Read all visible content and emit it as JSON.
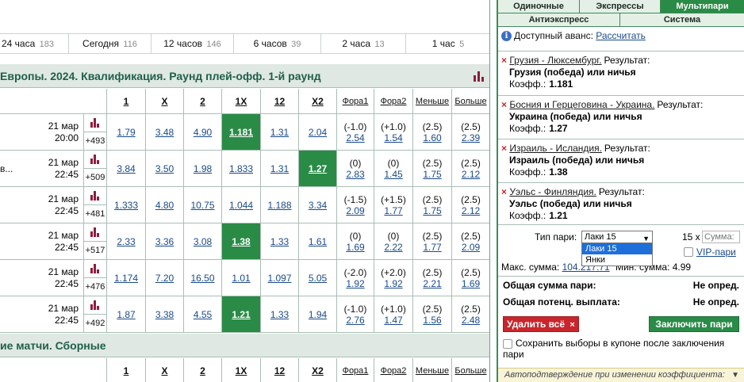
{
  "timebar": [
    {
      "label": "24 часа",
      "count": "183"
    },
    {
      "label": "Сегодня",
      "count": "116"
    },
    {
      "label": "12 часов",
      "count": "146"
    },
    {
      "label": "6 часов",
      "count": "39"
    },
    {
      "label": "2 часа",
      "count": "13"
    },
    {
      "label": "1 час",
      "count": "5"
    }
  ],
  "section1": {
    "title": "Европы. 2024. Квалификация. Раунд плей-офф. 1-й раунд"
  },
  "section2": {
    "title": "ие матчи. Сборные"
  },
  "headers": {
    "c1": "1",
    "cx": "X",
    "c2": "2",
    "c1x": "1X",
    "c12": "12",
    "cx2": "X2",
    "fora1": "Фора1",
    "fora2": "Фора2",
    "less": "Меньше",
    "more": "Больше"
  },
  "rows": [
    {
      "team": "",
      "date": "21 мар",
      "time": "20:00",
      "plus": "+493",
      "o1": "1.79",
      "ox": "3.48",
      "o2": "4.90",
      "o1x": "1.181",
      "o12": "1.31",
      "ox2": "2.04",
      "f1h": "(-1.0)",
      "f1": "2.54",
      "f2h": "(+1.0)",
      "f2": "1.54",
      "lh": "(2.5)",
      "l": "1.60",
      "mh": "(2.5)",
      "m": "2.39",
      "hl": "o1x"
    },
    {
      "team": "в...",
      "date": "21 мар",
      "time": "22:45",
      "plus": "+509",
      "o1": "3.84",
      "ox": "3.50",
      "o2": "1.98",
      "o1x": "1.833",
      "o12": "1.31",
      "ox2": "1.27",
      "f1h": "(0)",
      "f1": "2.83",
      "f2h": "(0)",
      "f2": "1.45",
      "lh": "(2.5)",
      "l": "1.75",
      "mh": "(2.5)",
      "m": "2.12",
      "hl": "ox2"
    },
    {
      "team": "",
      "date": "21 мар",
      "time": "22:45",
      "plus": "+481",
      "o1": "1.333",
      "ox": "4.80",
      "o2": "10.75",
      "o1x": "1.044",
      "o12": "1.188",
      "ox2": "3.34",
      "f1h": "(-1.5)",
      "f1": "2.09",
      "f2h": "(+1.5)",
      "f2": "1.77",
      "lh": "(2.5)",
      "l": "1.75",
      "mh": "(2.5)",
      "m": "2.12",
      "hl": ""
    },
    {
      "team": "",
      "date": "21 мар",
      "time": "22:45",
      "plus": "+517",
      "o1": "2.33",
      "ox": "3.36",
      "o2": "3.08",
      "o1x": "1.38",
      "o12": "1.33",
      "ox2": "1.61",
      "f1h": "(0)",
      "f1": "1.69",
      "f2h": "(0)",
      "f2": "2.22",
      "lh": "(2.5)",
      "l": "1.77",
      "mh": "(2.5)",
      "m": "2.09",
      "hl": "o1x"
    },
    {
      "team": "",
      "date": "21 мар",
      "time": "22:45",
      "plus": "+476",
      "o1": "1.174",
      "ox": "7.20",
      "o2": "16.50",
      "o1x": "1.01",
      "o12": "1.097",
      "ox2": "5.05",
      "f1h": "(-2.0)",
      "f1": "1.92",
      "f2h": "(+2.0)",
      "f2": "1.92",
      "lh": "(2.5)",
      "l": "2.21",
      "mh": "(2.5)",
      "m": "1.69",
      "hl": ""
    },
    {
      "team": "",
      "date": "21 мар",
      "time": "22:45",
      "plus": "+492",
      "o1": "1.87",
      "ox": "3.38",
      "o2": "4.55",
      "o1x": "1.21",
      "o12": "1.33",
      "ox2": "1.94",
      "f1h": "(-1.0)",
      "f1": "2.76",
      "f2h": "(+1.0)",
      "f2": "1.47",
      "lh": "(2.5)",
      "l": "1.56",
      "mh": "(2.5)",
      "m": "2.48",
      "hl": "o1x"
    }
  ],
  "panel": {
    "tabs": {
      "single": "Одиночные",
      "express": "Экспрессы",
      "multi": "Мультипари",
      "anti": "Антиэкспресс",
      "system": "Система"
    },
    "avans_label": "Доступный аванс:",
    "avans_link": "Рассчитать",
    "result_word": "Результат:",
    "coef_word": "Коэфф.:",
    "bets": [
      {
        "match": "Грузия - Люксембург.",
        "result": "Грузия (победа) или ничья",
        "coef": "1.181"
      },
      {
        "match": "Босния и Герцеговина - Украина.",
        "result": "Украина (победа) или ничья",
        "coef": "1.27"
      },
      {
        "match": "Израиль - Исландия.",
        "result": "Израиль (победа) или ничья",
        "coef": "1.38"
      },
      {
        "match": "Уэльс - Финляндия.",
        "result": "Уэльс (победа) или ничья",
        "coef": "1.21"
      }
    ],
    "bet_type_label": "Тип пари:",
    "bet_type_selected": "Лаки 15",
    "bet_type_options": [
      "Лаки 15",
      "Янки"
    ],
    "multiplier": "15 x",
    "sum_placeholder": "Сумма:",
    "vip_label": "VIP-пари",
    "max_sum_label": "Макс. сумма:",
    "max_sum_value": "104.217.71",
    "min_sum_label": "Мин. сумма:",
    "min_sum_value": "4.99",
    "total_sum_label": "Общая сумма пари:",
    "total_sum_value": "Не опред.",
    "total_payout_label": "Общая потенц. выплата:",
    "total_payout_value": "Не опред.",
    "delete_all": "Удалить всё",
    "submit": "Заключить пари",
    "keep_label": "Сохранить выборы в купоне после заключения пари",
    "auto_confirm": "Автоподтверждение при изменении коэффициента:"
  },
  "colors": {
    "accent": "#2a8b47",
    "danger": "#c8262c",
    "header": "#1f5f4a"
  }
}
